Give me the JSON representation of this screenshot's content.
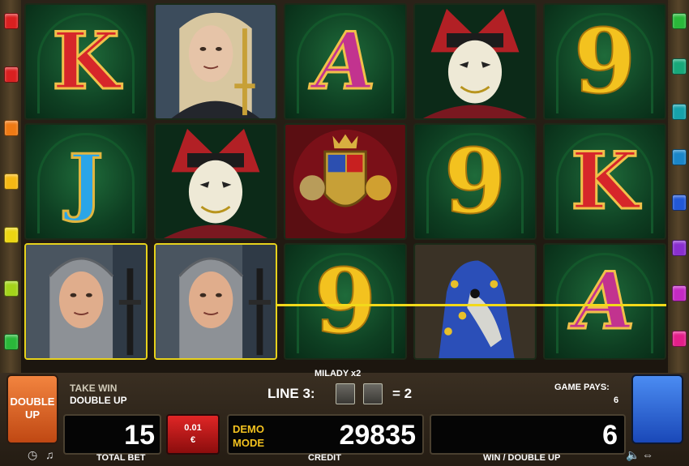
{
  "reels": [
    [
      {
        "kind": "letter",
        "symbol": "K"
      },
      {
        "kind": "letter",
        "symbol": "J"
      },
      {
        "kind": "portrait",
        "symbol": "knight-chainmail",
        "winning": true
      }
    ],
    [
      {
        "kind": "portrait",
        "symbol": "milady-swordsman"
      },
      {
        "kind": "portrait",
        "symbol": "jester-mask"
      },
      {
        "kind": "portrait",
        "symbol": "knight-chainmail",
        "winning": true
      }
    ],
    [
      {
        "kind": "letter",
        "symbol": "A"
      },
      {
        "kind": "portrait",
        "symbol": "coat-of-arms"
      },
      {
        "kind": "letter",
        "symbol": "9"
      }
    ],
    [
      {
        "kind": "portrait",
        "symbol": "jester-mask"
      },
      {
        "kind": "letter",
        "symbol": "9"
      },
      {
        "kind": "portrait",
        "symbol": "armored-horse"
      }
    ],
    [
      {
        "kind": "letter",
        "symbol": "9"
      },
      {
        "kind": "letter",
        "symbol": "K"
      },
      {
        "kind": "letter",
        "symbol": "A"
      }
    ]
  ],
  "left_pins": [
    "#d92020",
    "#d92020",
    "#ef7a14",
    "#f5b914",
    "#ecd612",
    "#a3d41a",
    "#2ab83a"
  ],
  "right_pins": [
    "#2ab83a",
    "#18a87a",
    "#16a2ab",
    "#1a86c9",
    "#2258d6",
    "#8a2fd0",
    "#c42ac4",
    "#e41f8a"
  ],
  "win_info": {
    "title": "MILADY x2",
    "line_label": "LINE 3:",
    "line_result": "= 2"
  },
  "controls": {
    "double_up_button": "DOUBLE UP",
    "take_win": "TAKE WIN",
    "double_up": "DOUBLE UP",
    "game_pays_label": "GAME PAYS:",
    "game_pays_value": "6",
    "total_bet": "15",
    "total_bet_label": "TOTAL BET",
    "denomination": "0.01",
    "currency": "€",
    "demo": "DEMO",
    "mode": "MODE",
    "credit": "29835",
    "credit_label": "CREDIT",
    "win": "6",
    "win_label": "WIN / DOUBLE UP"
  },
  "icons": [
    "clock-icon",
    "music-note-icon",
    "speaker-icon",
    "fullscreen-icon"
  ]
}
